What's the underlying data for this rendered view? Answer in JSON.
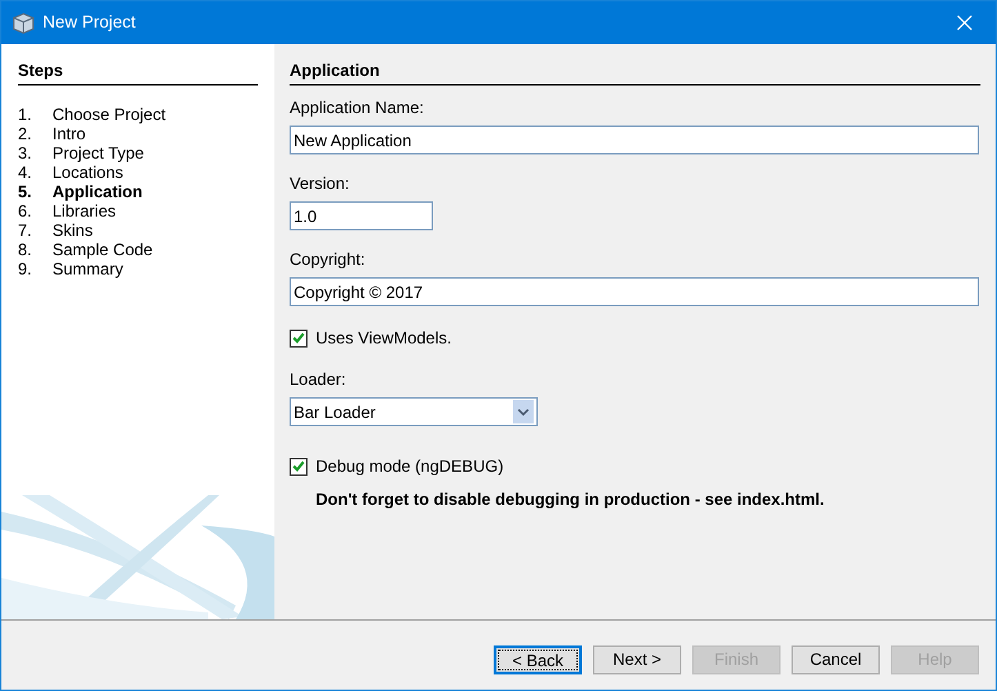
{
  "window": {
    "title": "New Project"
  },
  "steps": {
    "heading": "Steps",
    "items": [
      {
        "number": "1.",
        "label": "Choose Project",
        "selected": false
      },
      {
        "number": "2.",
        "label": "Intro",
        "selected": false
      },
      {
        "number": "3.",
        "label": "Project Type",
        "selected": false
      },
      {
        "number": "4.",
        "label": "Locations",
        "selected": false
      },
      {
        "number": "5.",
        "label": "Application",
        "selected": true
      },
      {
        "number": "6.",
        "label": "Libraries",
        "selected": false
      },
      {
        "number": "7.",
        "label": "Skins",
        "selected": false
      },
      {
        "number": "8.",
        "label": "Sample Code",
        "selected": false
      },
      {
        "number": "9.",
        "label": "Summary",
        "selected": false
      }
    ]
  },
  "panel": {
    "heading": "Application",
    "items": [
      {
        "kind": "text",
        "label": "Application Name:",
        "value": "New Application"
      },
      {
        "kind": "short_text",
        "label": "Version:",
        "value": "1.0"
      },
      {
        "kind": "text",
        "label": "Copyright:",
        "value": "Copyright © 2017"
      },
      {
        "kind": "checkbox",
        "label": "Uses ViewModels.",
        "checked": true
      },
      {
        "kind": "select",
        "label": "Loader:",
        "value": "Bar Loader"
      },
      {
        "kind": "checkbox",
        "label": "Debug mode (ngDEBUG)",
        "checked": true
      },
      {
        "kind": "note",
        "text": "Don't forget to disable debugging in production - see index.html."
      }
    ]
  },
  "buttons": [
    {
      "label": "< Back",
      "disabled": false,
      "focused": true
    },
    {
      "label": "Next >",
      "disabled": false,
      "focused": false
    },
    {
      "label": "Finish",
      "disabled": true,
      "focused": false
    },
    {
      "label": "Cancel",
      "disabled": false,
      "focused": false
    },
    {
      "label": "Help",
      "disabled": true,
      "focused": false
    }
  ]
}
